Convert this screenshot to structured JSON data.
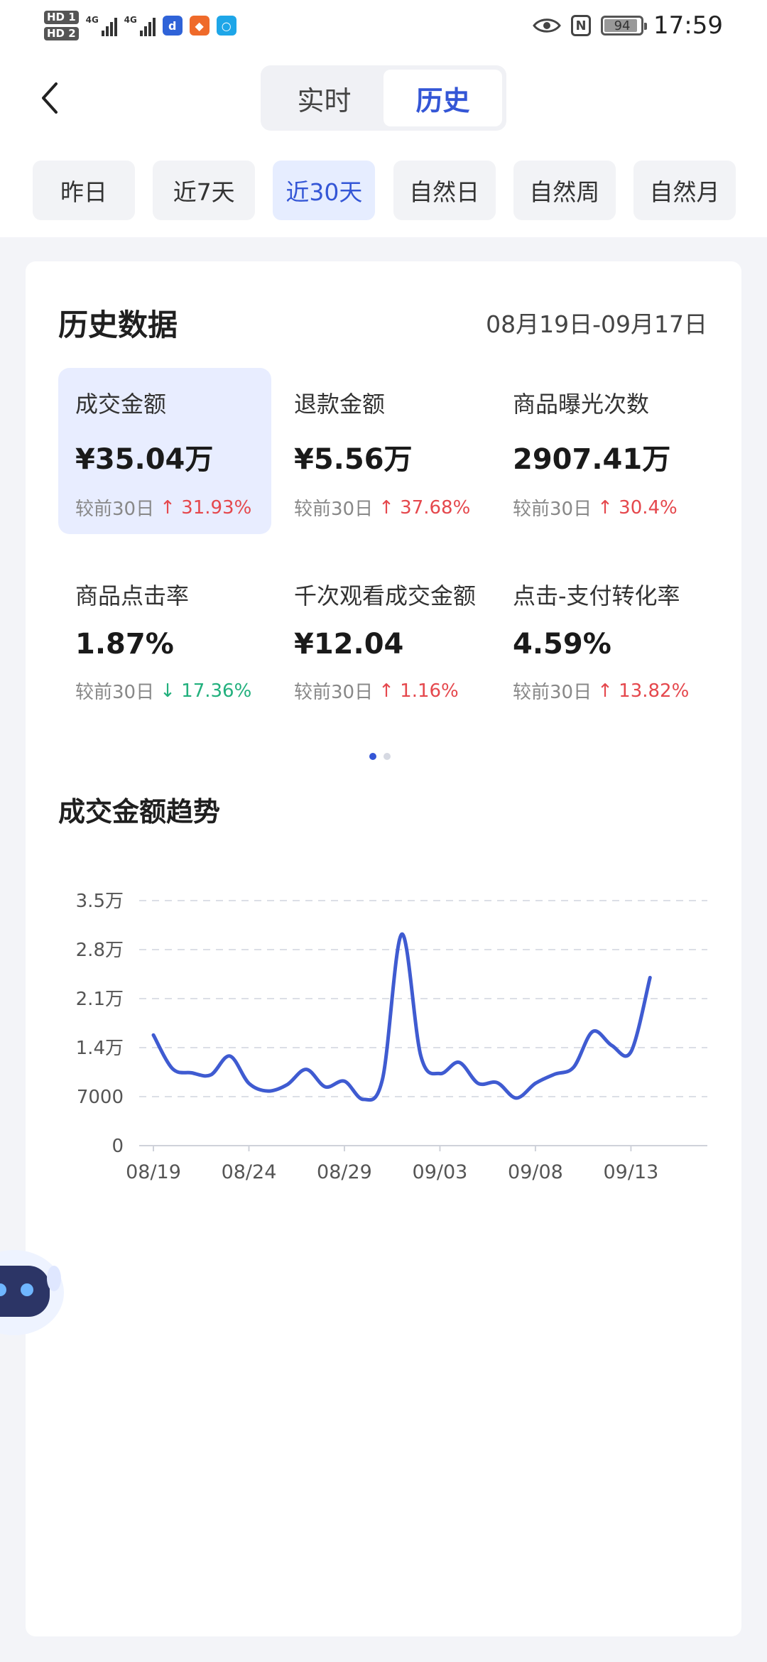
{
  "status_bar": {
    "sim1": "HD 1",
    "sim2": "HD 2",
    "network1": "4G",
    "network2": "4G",
    "battery": "94",
    "time": "17:59"
  },
  "nav": {
    "tabs": [
      {
        "label": "实时",
        "active": false
      },
      {
        "label": "历史",
        "active": true
      }
    ]
  },
  "filters": [
    {
      "label": "昨日",
      "active": false
    },
    {
      "label": "近7天",
      "active": false
    },
    {
      "label": "近30天",
      "active": true
    },
    {
      "label": "自然日",
      "active": false
    },
    {
      "label": "自然周",
      "active": false
    },
    {
      "label": "自然月",
      "active": false
    }
  ],
  "history": {
    "title": "历史数据",
    "date_range": "08月19日-09月17日",
    "metrics": [
      {
        "label": "成交金额",
        "value": "¥35.04万",
        "compare_label": "较前30日",
        "arrow": "↑",
        "change": "31.93%",
        "trend": "up",
        "active": true
      },
      {
        "label": "退款金额",
        "value": "¥5.56万",
        "compare_label": "较前30日",
        "arrow": "↑",
        "change": "37.68%",
        "trend": "up",
        "active": false
      },
      {
        "label": "商品曝光次数",
        "value": "2907.41万",
        "compare_label": "较前30日",
        "arrow": "↑",
        "change": "30.4%",
        "trend": "up",
        "active": false
      },
      {
        "label": "商品点击率",
        "value": "1.87%",
        "compare_label": "较前30日",
        "arrow": "↓",
        "change": "17.36%",
        "trend": "down",
        "active": false
      },
      {
        "label": "千次观看成交金额",
        "value": "¥12.04",
        "compare_label": "较前30日",
        "arrow": "↑",
        "change": "1.16%",
        "trend": "up",
        "active": false
      },
      {
        "label": "点击-支付转化率",
        "value": "4.59%",
        "compare_label": "较前30日",
        "arrow": "↑",
        "change": "13.82%",
        "trend": "up",
        "active": false
      }
    ],
    "page_index": 1,
    "page_count": 2
  },
  "trend": {
    "title": "成交金额趋势"
  },
  "chart_data": {
    "type": "line",
    "title": "成交金额趋势",
    "xlabel": "",
    "ylabel": "",
    "grid": true,
    "legend": "none",
    "yticks": [
      0,
      7000,
      14000,
      21000,
      28000,
      35000
    ],
    "ytick_labels": [
      "0",
      "7000",
      "1.4万",
      "2.1万",
      "2.8万",
      "3.5万"
    ],
    "ylim": [
      0,
      35000
    ],
    "xtick_labels": [
      "08/19",
      "08/24",
      "08/29",
      "09/03",
      "09/08",
      "09/13"
    ],
    "x": [
      "08/19",
      "08/20",
      "08/21",
      "08/22",
      "08/23",
      "08/24",
      "08/25",
      "08/26",
      "08/27",
      "08/28",
      "08/29",
      "08/30",
      "08/31",
      "09/01",
      "09/02",
      "09/03",
      "09/04",
      "09/05",
      "09/06",
      "09/07",
      "09/08",
      "09/09",
      "09/10",
      "09/11",
      "09/12",
      "09/13",
      "09/14",
      "09/15",
      "09/16",
      "09/17"
    ],
    "series": [
      {
        "color": "#3f5bd1",
        "values": [
          15800,
          11000,
          10400,
          10100,
          12800,
          8900,
          7800,
          8700,
          10900,
          8400,
          9200,
          6600,
          9600,
          30200,
          12800,
          10300,
          11900,
          8900,
          9000,
          6800,
          8900,
          10200,
          11200,
          16300,
          14300,
          13400,
          24000
        ]
      }
    ]
  }
}
